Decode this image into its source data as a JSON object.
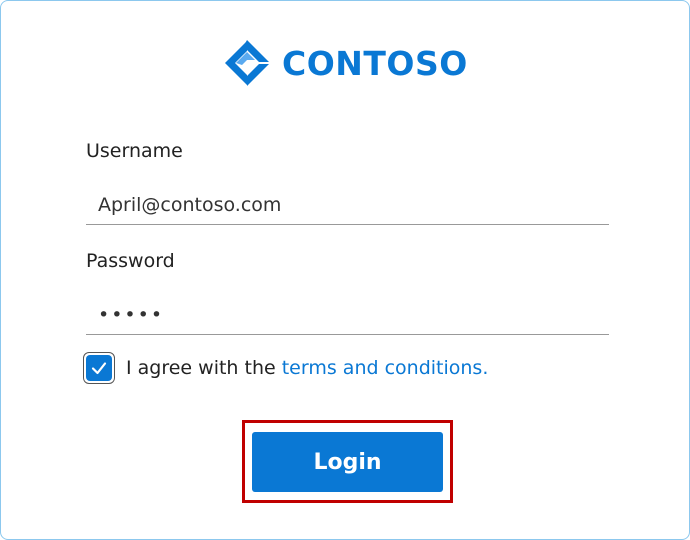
{
  "logo": {
    "text": "CONTOSO",
    "color": "#0a78d4"
  },
  "form": {
    "username_label": "Username",
    "username_value": "April@contoso.com",
    "password_label": "Password",
    "password_value": "•••••",
    "agree_text": "I agree with the ",
    "terms_link": "terms and conditions.",
    "agree_checked": true,
    "login_label": "Login"
  }
}
